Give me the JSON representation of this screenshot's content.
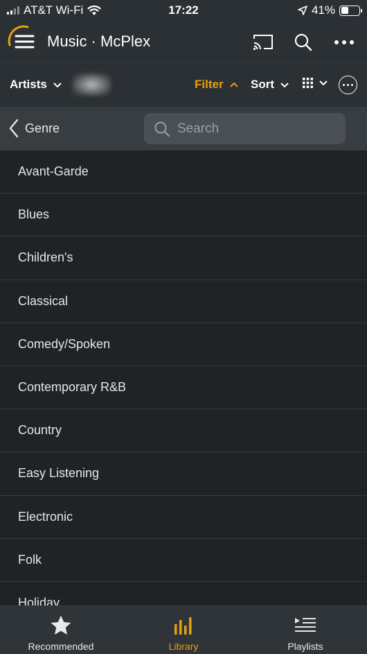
{
  "status_bar": {
    "carrier": "AT&T Wi-Fi",
    "time": "17:22",
    "battery_text": "41%",
    "battery_level": 0.41,
    "icons": [
      "signal-icon",
      "wifi-icon",
      "location-arrow-icon",
      "battery-icon"
    ]
  },
  "header": {
    "title": "Music · McPlex",
    "icons": [
      "menu-icon",
      "cast-icon",
      "search-icon",
      "more-horizontal-icon"
    ]
  },
  "toolbar": {
    "section_label": "Artists",
    "filter_label": "Filter",
    "sort_label": "Sort",
    "accent_color": "#e5a00d"
  },
  "filter_bar": {
    "back_label": "Genre",
    "search_placeholder": "Search"
  },
  "genres": [
    "Avant-Garde",
    "Blues",
    "Children's",
    "Classical",
    "Comedy/Spoken",
    "Contemporary R&B",
    "Country",
    "Easy Listening",
    "Electronic",
    "Folk",
    "Holiday"
  ],
  "tabs": [
    {
      "label": "Recommended",
      "icon": "star-icon",
      "active": false
    },
    {
      "label": "Library",
      "icon": "library-bars-icon",
      "active": true
    },
    {
      "label": "Playlists",
      "icon": "playlist-icon",
      "active": false
    }
  ]
}
